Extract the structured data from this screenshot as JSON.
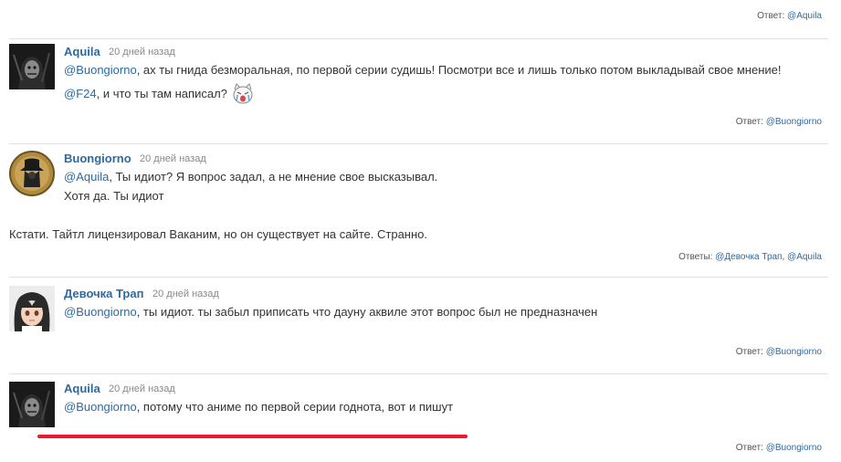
{
  "comments": [
    {
      "author": "Aquila",
      "date": "20 дней назад",
      "lines": [
        {
          "mention": "@Buongiorno",
          "text": ", ах ты гнида безморальная, по первой серии судишь! Посмотри все и лишь только потом выкладывай свое мнение!"
        },
        {
          "mention": "@F24",
          "text": ", и что ты там написал?"
        }
      ],
      "emoji": "crying-cat-emoji",
      "reply_label": "Ответ:",
      "reply_to": [
        "@Buongiorno"
      ]
    },
    {
      "author": "Buongiorno",
      "date": "20 дней назад",
      "lines": [
        {
          "mention": "@Aquila",
          "text": ", Ты идиот? Я вопрос задал, а не мнение свое высказывал."
        },
        {
          "mention": "",
          "text": "Хотя да. Ты идиот"
        },
        {
          "mention": "",
          "text": "Кстати. Тайтл лицензировал Ваканим, но он существует на сайте. Странно."
        }
      ],
      "reply_label": "Ответы:",
      "reply_to": [
        "@Девочка Трап",
        "@Aquila"
      ]
    },
    {
      "author": "Девочка Трап",
      "date": "20 дней назад",
      "lines": [
        {
          "mention": "@Buongiorno",
          "text": ", ты идиот. ты забыл приписать что дауну аквиле этот вопрос был не предназначен"
        }
      ],
      "reply_label": "Ответ:",
      "reply_to": [
        "@Buongiorno"
      ]
    },
    {
      "author": "Aquila",
      "date": "20 дней назад",
      "lines": [
        {
          "mention": "@Buongiorno",
          "text": ", потому что аниме по первой серии годнота, вот и пишут"
        }
      ],
      "reply_label": "Ответ:",
      "reply_to": [
        "@Buongiorno"
      ]
    }
  ],
  "top_reply": {
    "label": "Ответ:",
    "to": "@Aquila"
  },
  "colors": {
    "link": "#2b6aa3",
    "highlight": "#e8182d"
  }
}
